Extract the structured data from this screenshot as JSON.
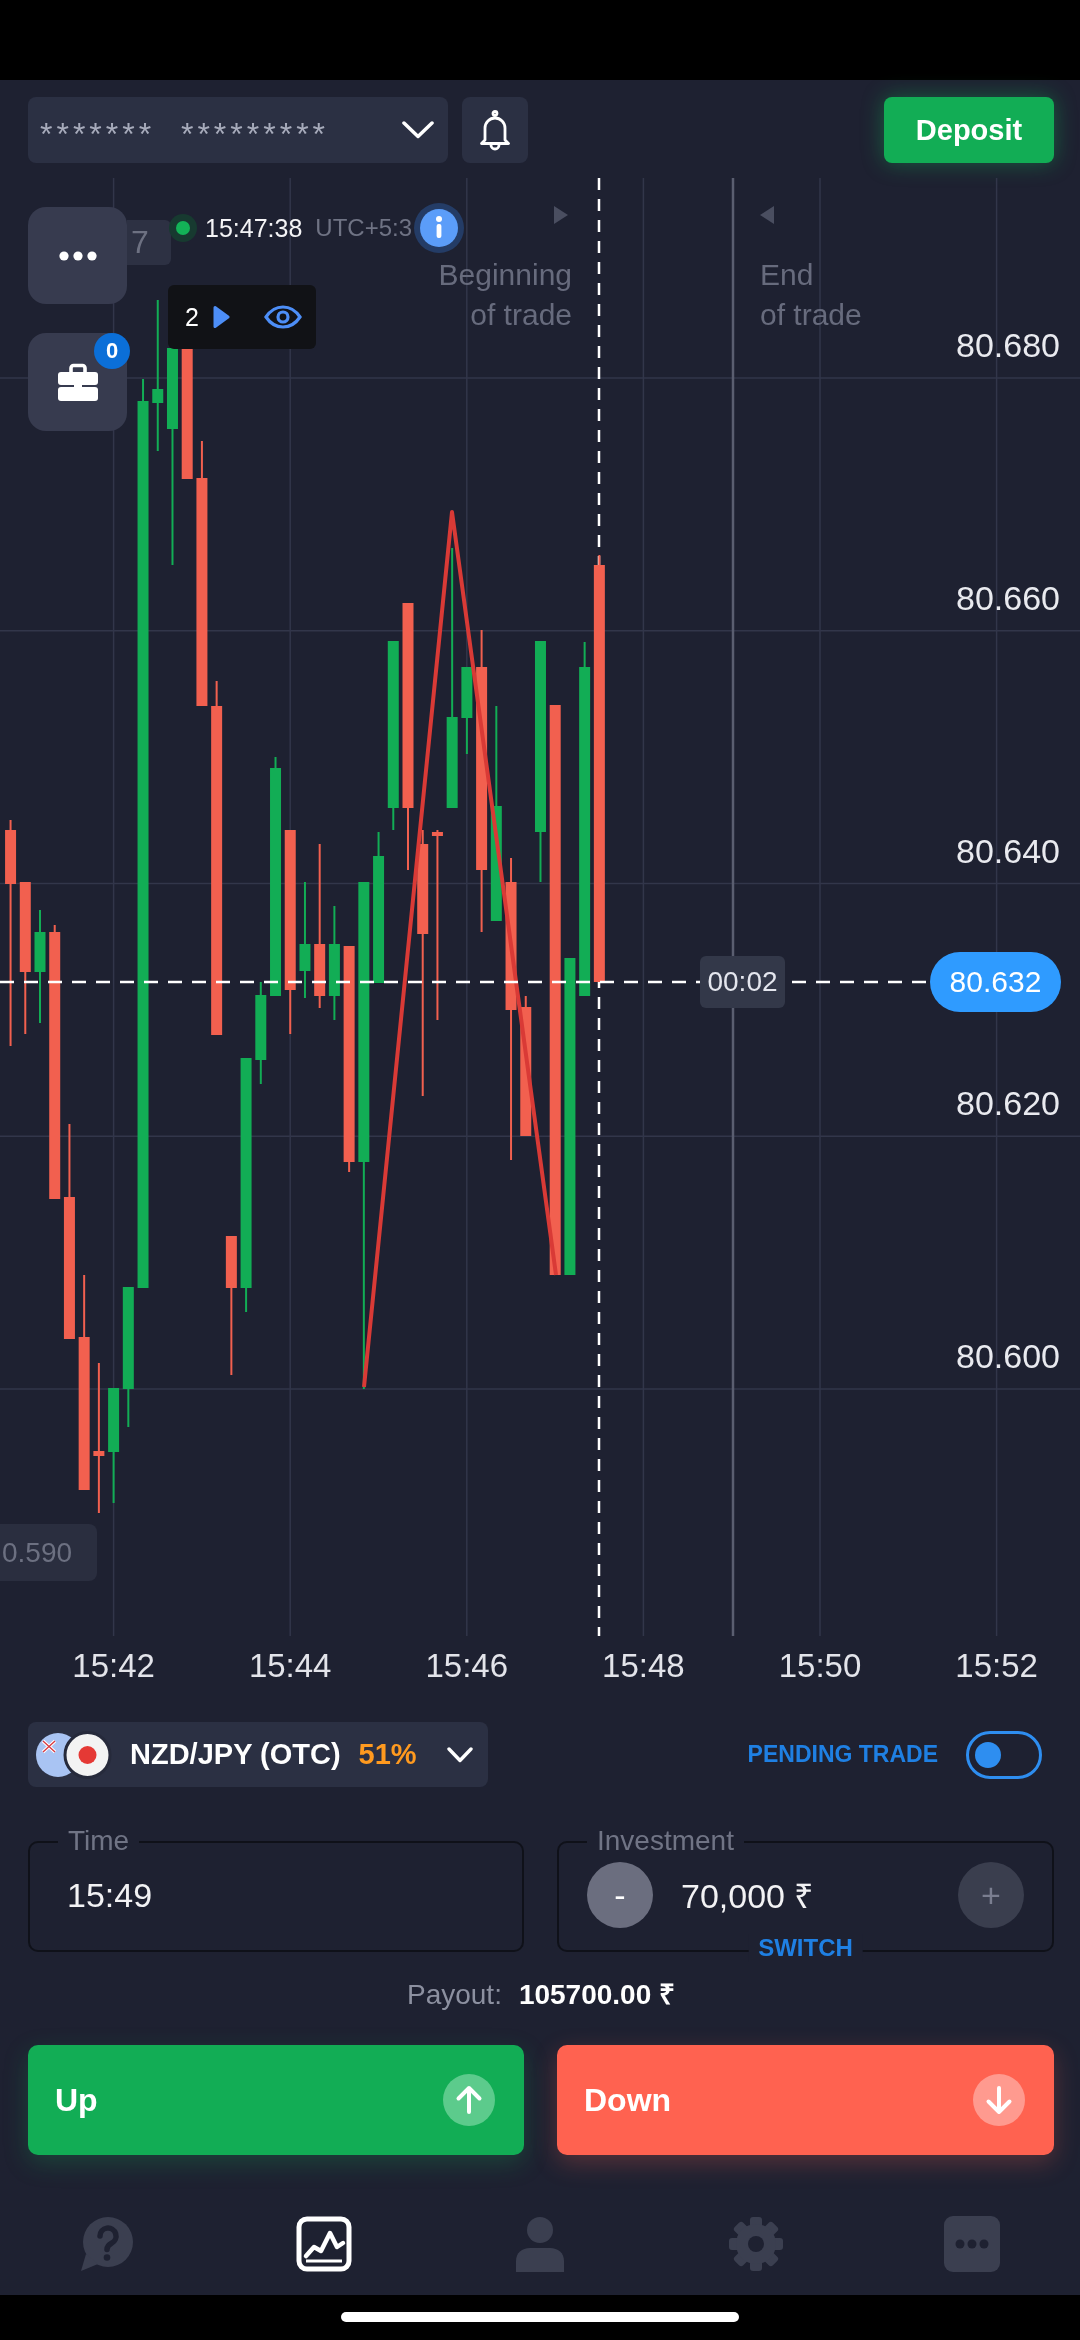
{
  "header": {
    "balance": "*******  *********",
    "deposit": "Deposit"
  },
  "chart": {
    "clock": "15:47:38",
    "timezone": "UTC+5:3",
    "side_tab": "7",
    "open_trades": "0",
    "popup_count": "2",
    "markers": [
      {
        "kind": "start",
        "label": "Beginning\nof trade"
      },
      {
        "kind": "end",
        "label": "End\nof trade"
      }
    ],
    "price_ticks": [
      "80.680",
      "80.660",
      "80.640",
      "80.620",
      "80.600"
    ],
    "time_ticks": [
      "15:42",
      "15:44",
      "15:46",
      "15:48",
      "15:50",
      "15:52"
    ],
    "countdown": "00:02",
    "current_price": "80.632",
    "edge_price": "0.590"
  },
  "asset": {
    "name": "NZD/JPY (OTC)",
    "payout_percent": "51%"
  },
  "pending_trade": {
    "label": "PENDING TRADE",
    "on": false
  },
  "time_field": {
    "label": "Time",
    "value": "15:49"
  },
  "investment_field": {
    "label": "Investment",
    "value": "70,000 ₹",
    "decrease": "-",
    "increase": "+",
    "switch": "SWITCH"
  },
  "payout": {
    "label": "Payout:",
    "value": "105700.00 ₹"
  },
  "trade_buttons": [
    {
      "kind": "up",
      "label": "Up"
    },
    {
      "kind": "down",
      "label": "Down"
    }
  ],
  "bottom_nav": [
    {
      "kind": "help",
      "selected": false
    },
    {
      "kind": "chart",
      "selected": true
    },
    {
      "kind": "profile",
      "selected": false
    },
    {
      "kind": "settings",
      "selected": false
    },
    {
      "kind": "more",
      "selected": false
    }
  ]
}
